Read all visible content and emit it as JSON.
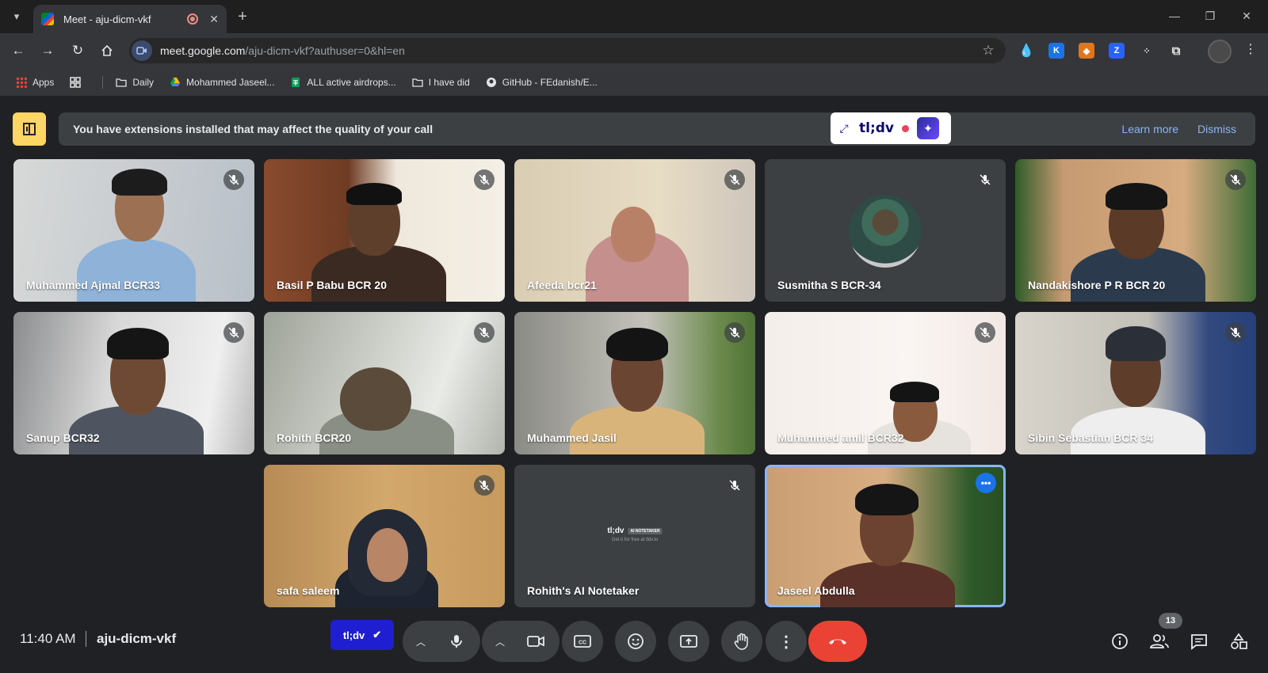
{
  "browser": {
    "tab_title": "Meet - aju-dicm-vkf",
    "url_host": "meet.google.com",
    "url_path": "/aju-dicm-vkf?authuser=0&hl=en",
    "bookmarks": [
      {
        "label": "Apps",
        "icon": "apps-grid-icon"
      },
      {
        "label": "",
        "icon": "tab-groups-icon"
      },
      {
        "label": "Daily",
        "icon": "folder-icon"
      },
      {
        "label": "Mohammed Jaseel...",
        "icon": "drive-icon"
      },
      {
        "label": "ALL active airdrops...",
        "icon": "sheets-icon"
      },
      {
        "label": "I have did",
        "icon": "folder-icon"
      },
      {
        "label": "GitHub - FEdanish/E...",
        "icon": "github-icon"
      }
    ],
    "extensions": [
      "drop-icon",
      "k-extension-icon",
      "metamask-icon",
      "z-extension-icon",
      "dots-extension-icon",
      "puzzle-icon"
    ]
  },
  "banner": {
    "message": "You have extensions installed that may affect the quality of your call",
    "learn_more": "Learn more",
    "dismiss": "Dismiss"
  },
  "tldv_widget": {
    "logo": "tl;dv"
  },
  "participants": [
    {
      "name": "Muhammed Ajmal BCR33",
      "muted": true
    },
    {
      "name": "Basil P Babu BCR 20",
      "muted": true
    },
    {
      "name": "Afeeda bcr21",
      "muted": true
    },
    {
      "name": "Susmitha S BCR-34",
      "muted": true
    },
    {
      "name": "Nandakishore P R BCR 20",
      "muted": true
    },
    {
      "name": "Sanup BCR32",
      "muted": true
    },
    {
      "name": "Rohith BCR20",
      "muted": true
    },
    {
      "name": "Muhammed Jasil",
      "muted": true
    },
    {
      "name": "Muhammed amil BCR32",
      "muted": true
    },
    {
      "name": "Sibin Sebastian BCR 34",
      "muted": true
    },
    {
      "name": "safa saleem",
      "muted": true
    },
    {
      "name": "Rohith's AI Notetaker",
      "muted": true
    },
    {
      "name": "Jaseel Abdulla",
      "muted": false
    }
  ],
  "notetaker_card": {
    "logo": "tl;dv",
    "tag": "AI NOTETAKER",
    "sub": "Get it for free at tldv.io"
  },
  "bottom_bar": {
    "time": "11:40 AM",
    "meeting_code": "aju-dicm-vkf",
    "tldv_button": "tl;dv",
    "participant_count": "13"
  }
}
